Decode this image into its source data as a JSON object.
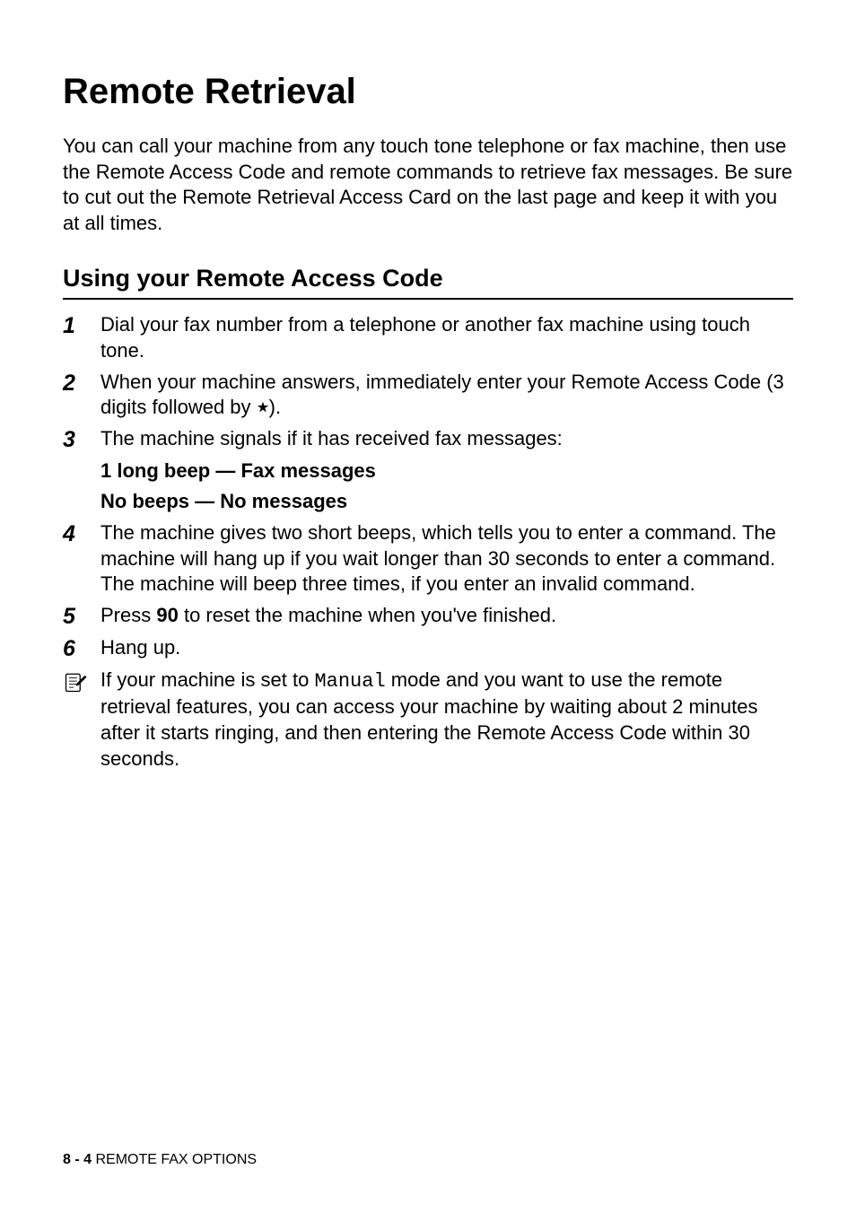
{
  "title": "Remote Retrieval",
  "intro": "You can call your machine from any touch tone telephone or fax machine, then use the Remote Access Code and remote commands to retrieve fax messages. Be sure to cut out the Remote Retrieval Access Card on the last page and keep it with you at all times.",
  "section_heading": "Using your Remote Access Code",
  "steps": {
    "s1": {
      "num": "1",
      "text": "Dial your fax number from a telephone or another fax machine using touch tone."
    },
    "s2": {
      "num": "2",
      "pre": "When your machine answers, immediately enter your Remote Access Code (3 digits followed by ",
      "post": ")."
    },
    "s3": {
      "num": "3",
      "text": "The machine signals if it has received fax messages:"
    },
    "s3a": "1 long beep — Fax messages",
    "s3b": "No beeps — No messages",
    "s4": {
      "num": "4",
      "text": "The machine gives two short beeps, which tells you to enter a command. The machine will hang up if you wait longer than 30 seconds to enter a command. The machine will beep three times, if you enter an invalid command."
    },
    "s5": {
      "num": "5",
      "pre": "Press ",
      "bold": "90",
      "post": " to reset the machine when you've finished."
    },
    "s6": {
      "num": "6",
      "text": "Hang up."
    }
  },
  "note": {
    "pre": "If your machine is set to ",
    "mono": "Manual",
    "post": " mode and you want to use the remote retrieval features, you can access your machine by waiting about 2 minutes after it starts ringing, and then entering the Remote Access Code within 30 seconds."
  },
  "footer": {
    "page": "8 - 4",
    "section": "REMOTE FAX OPTIONS",
    "sep": "   "
  },
  "chart_data": null
}
